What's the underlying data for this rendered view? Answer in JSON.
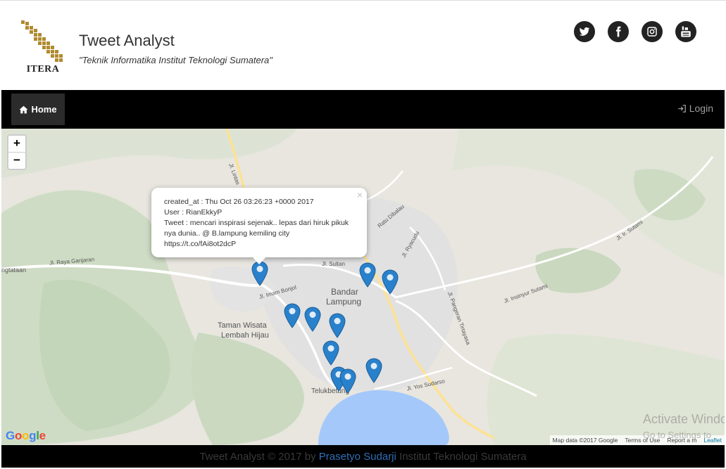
{
  "header": {
    "logo_text": "ITERA",
    "title": "Tweet Analyst",
    "subtitle": "\"Teknik Informatika Institut Teknologi Sumatera\"",
    "social": [
      "twitter-icon",
      "facebook-icon",
      "instagram-icon",
      "youtube-icon"
    ]
  },
  "nav": {
    "home": "Home",
    "login": "Login"
  },
  "map": {
    "zoom_in": "+",
    "zoom_out": "−",
    "popup": {
      "close": "×",
      "created_at": "created_at : Thu Oct 26 03:26:23 +0000 2017",
      "user": "User : RianEkkyP",
      "tweet1": "Tweet : mencari inspirasi sejenak.. lepas dari hiruk pikuk",
      "tweet2": "nya dunia.. @ B.lampung kemiling city",
      "tweet3": "https://t.co/fAi8ot2dcP"
    },
    "labels": {
      "city": "Bandar",
      "city2": "Lampung",
      "park": "Taman Wisata",
      "park2": "Lembah Hijau",
      "bay": "Telukbetung",
      "left_town": "ngtataan",
      "road1": "Jl. Raya Ganjaran",
      "road2": "Jl. Imam Bonjol",
      "road3": "Jl. Sultan",
      "road4": "Jl. Insinyur Sutami",
      "road5": "Jl. Ir. Sutami",
      "road6": "Jl. Pangeran Tirtayasa",
      "road7": "Jl. Ryacudu",
      "road8": "Jl. Yos Sudarso",
      "road9": "Ratu Dibalau",
      "road10": "Jl. Lintas"
    },
    "google": "Google",
    "attribution": {
      "data": "Map data ©2017 Google",
      "terms": "Terms of Use",
      "report": "Report a m",
      "leaflet": "Leaflet"
    },
    "watermark": {
      "line1": "Activate Windows",
      "line2": "Go to Settings to"
    }
  },
  "footer": {
    "prefix": "Tweet Analyst © 2017 by ",
    "author": "Prasetyo Sudarji",
    "suffix": " Institut Teknologi Sumatera"
  },
  "colors": {
    "marker": "#2a81cb",
    "navbar": "#000000",
    "map_land": "#e8e6df",
    "water": "#a5c8fb",
    "urban": "#e0e0e0"
  }
}
